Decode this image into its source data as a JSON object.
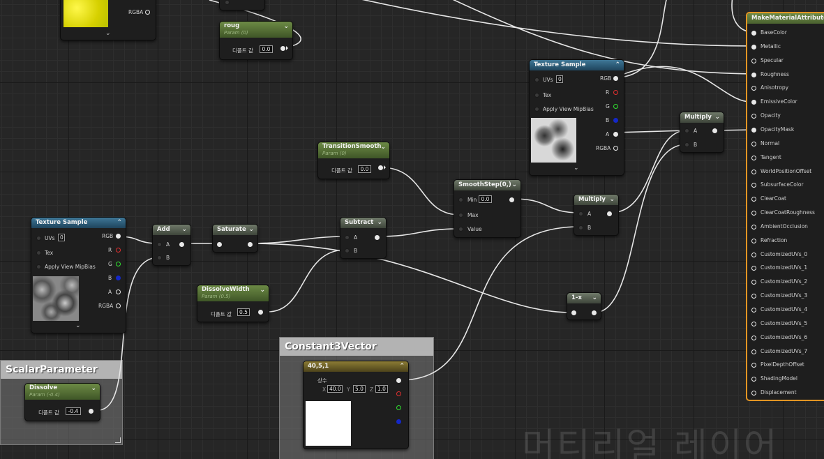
{
  "editor": {
    "param_label": "디폴트 값",
    "watermark": "머티리얼 레이어"
  },
  "nodes": {
    "topleft_tex": {
      "rgba": "RGBA"
    },
    "roug": {
      "title": "roug",
      "sub": "Param (0)",
      "value": "0.0"
    },
    "transition": {
      "title": "TransitionSmooth",
      "sub": "Param (0)",
      "value": "0.0"
    },
    "tex_sample_left": {
      "title": "Texture Sample",
      "uvs": "UVs",
      "uvs_value": "0",
      "tex": "Tex",
      "mip": "Apply View MipBias",
      "rgb": "RGB",
      "r": "R",
      "g": "G",
      "b": "B",
      "a": "A",
      "rgba": "RGBA"
    },
    "tex_sample_right": {
      "title": "Texture Sample",
      "uvs": "UVs",
      "uvs_value": "0",
      "tex": "Tex",
      "mip": "Apply View MipBias",
      "rgb": "RGB",
      "r": "R",
      "g": "G",
      "b": "B",
      "a": "A",
      "rgba": "RGBA"
    },
    "add": {
      "title": "Add",
      "a": "A",
      "b": "B"
    },
    "saturate": {
      "title": "Saturate"
    },
    "subtract": {
      "title": "Subtract",
      "a": "A",
      "b": "B"
    },
    "smoothstep": {
      "title": "SmoothStep(0,)",
      "min": "Min",
      "min_value": "0.0",
      "max": "Max",
      "value": "Value"
    },
    "multiply_mid": {
      "title": "Multiply",
      "a": "A",
      "b": "B"
    },
    "multiply_top": {
      "title": "Multiply",
      "a": "A",
      "b": "B"
    },
    "oneminus": {
      "title": "1-x"
    },
    "dissolve_width": {
      "title": "DissolveWidth",
      "sub": "Param (0.5)",
      "value": "0.5"
    },
    "dissolve": {
      "title": "Dissolve",
      "sub": "Param (-0.4)",
      "value": "-0.4"
    },
    "const3": {
      "title": "40,5,1",
      "label": "상수",
      "x": "X",
      "x_value": "40.0",
      "y": "Y",
      "y_value": "5.0",
      "z": "Z",
      "z_value": "1.0"
    }
  },
  "comments": {
    "scalar": "ScalarParameter",
    "const3": "Constant3Vector"
  },
  "material": {
    "title": "MakeMaterialAttributes",
    "inputs": [
      "BaseColor",
      "Metallic",
      "Specular",
      "Roughness",
      "Anisotropy",
      "EmissiveColor",
      "Opacity",
      "OpacityMask",
      "Normal",
      "Tangent",
      "WorldPositionOffset",
      "SubsurfaceColor",
      "ClearCoat",
      "ClearCoatRoughness",
      "AmbientOcclusion",
      "Refraction",
      "CustomizedUVs_0",
      "CustomizedUVs_1",
      "CustomizedUVs_2",
      "CustomizedUVs_3",
      "CustomizedUVs_4",
      "CustomizedUVs_5",
      "CustomizedUVs_6",
      "CustomizedUVs_7",
      "PixelDepthOffset",
      "ShadingModel",
      "Displacement"
    ],
    "connected": [
      "BaseColor",
      "Metallic",
      "Roughness",
      "EmissiveColor",
      "OpacityMask"
    ]
  }
}
